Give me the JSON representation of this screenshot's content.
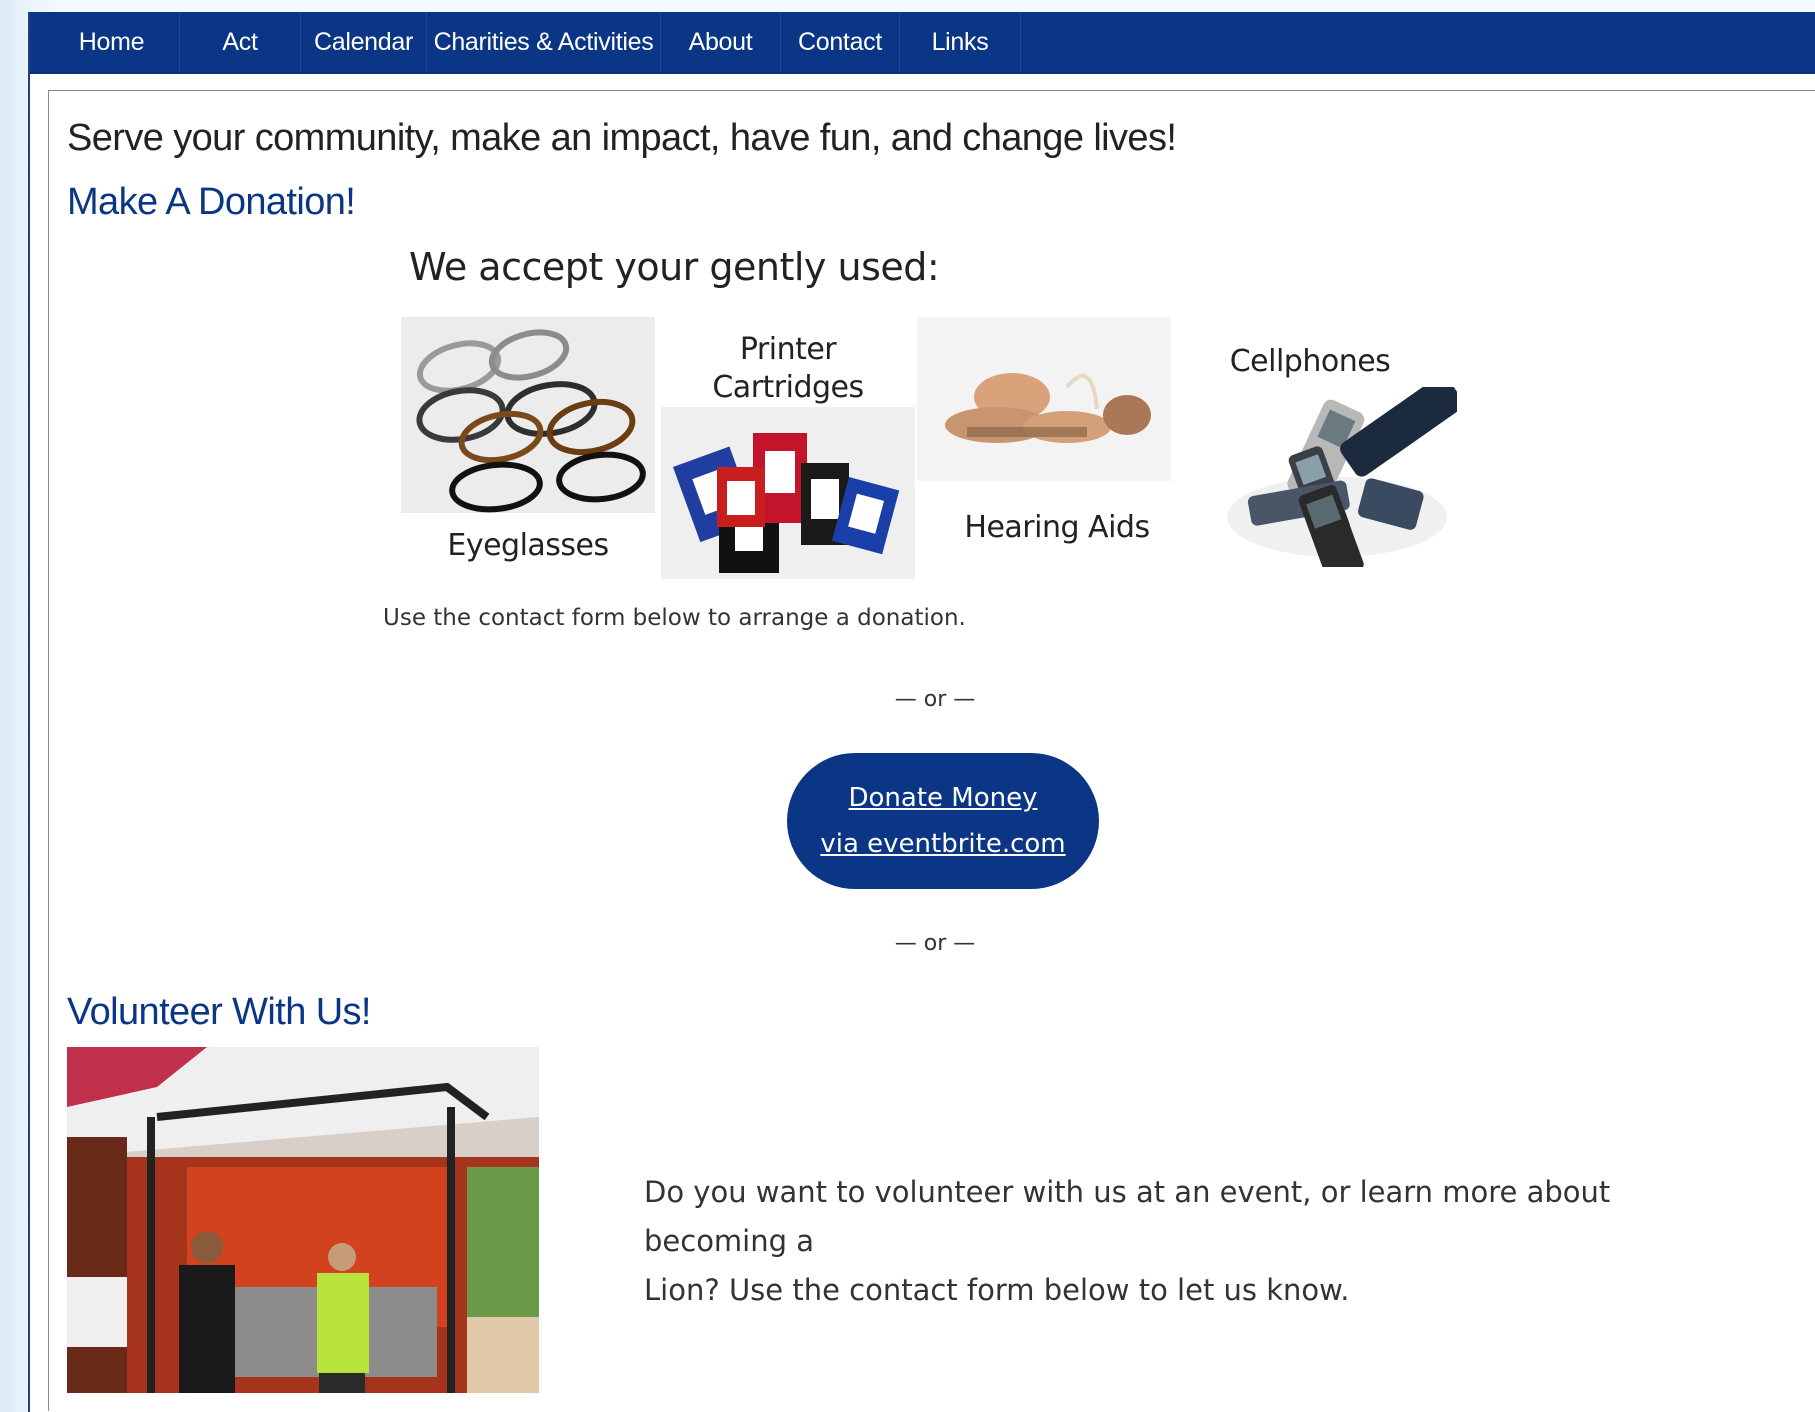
{
  "nav": {
    "items": [
      {
        "label": "Home"
      },
      {
        "label": "Act"
      },
      {
        "label": "Calendar"
      },
      {
        "label": "Charities & Activities"
      },
      {
        "label": "About"
      },
      {
        "label": "Contact"
      },
      {
        "label": "Links"
      }
    ]
  },
  "main": {
    "tagline": "Serve your community, make an impact, have fun, and change lives!",
    "donation": {
      "heading": "Make A Donation!",
      "accept_title": "We accept your gently used:",
      "items": [
        {
          "label": "Eyeglasses"
        },
        {
          "label_line1": "Printer",
          "label_line2": "Cartridges"
        },
        {
          "label": "Hearing Aids"
        },
        {
          "label": "Cellphones"
        }
      ],
      "contact_note": "Use the contact form below to arrange a donation.",
      "or_separator": "— or —",
      "donate_button": {
        "line1": "Donate Money",
        "line2": "via eventbrite.com"
      }
    },
    "volunteer": {
      "heading": "Volunteer With Us!",
      "text_line1": "Do you want to volunteer with us at an event, or learn more about becoming a",
      "text_line2": "Lion? Use the contact form below to let us know."
    }
  },
  "colors": {
    "brand_blue": "#0b3685",
    "heading_blue": "#0b3685"
  }
}
